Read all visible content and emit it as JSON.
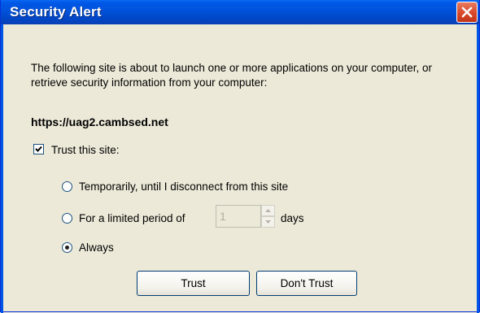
{
  "dialog": {
    "title": "Security Alert",
    "intro": "The following site is about to launch one or more applications on your computer, or retrieve security information from your computer:",
    "site_url": "https://uag2.cambsed.net",
    "trust_checkbox": {
      "label": "Trust this site:",
      "checked": true
    },
    "options": [
      {
        "label": "Temporarily, until I disconnect from this site",
        "selected": false
      },
      {
        "label": "For a limited period of",
        "selected": false
      },
      {
        "label": "Always",
        "selected": true
      }
    ],
    "period": {
      "value": "1",
      "unit": "days"
    },
    "buttons": {
      "trust": "Trust",
      "dont_trust": "Don't Trust"
    }
  },
  "colors": {
    "title_bar": "#0052d9",
    "close_button": "#d9482a",
    "dialog_bg": "#ece9d8"
  },
  "icons": [
    "close-icon",
    "checkmark-icon",
    "spin-up-icon",
    "spin-down-icon"
  ]
}
